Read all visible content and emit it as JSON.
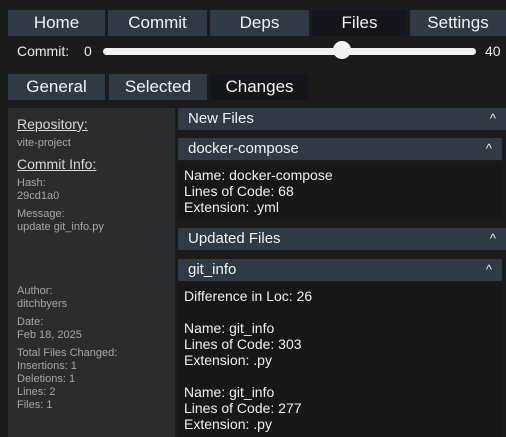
{
  "nav": {
    "tabs": [
      {
        "label": "Home"
      },
      {
        "label": "Commit"
      },
      {
        "label": "Deps"
      },
      {
        "label": "Files"
      },
      {
        "label": "Settings"
      }
    ],
    "active": "Files"
  },
  "commit_slider": {
    "label": "Commit:",
    "min": "0",
    "max": "40",
    "value_fraction": 0.64
  },
  "subtabs": [
    {
      "label": "General"
    },
    {
      "label": "Selected"
    },
    {
      "label": "Changes"
    }
  ],
  "sidebar": {
    "repository_heading": "Repository:",
    "repository": "vite-project",
    "commit_info_heading": "Commit Info:",
    "hash_label": "Hash:",
    "hash": "29cd1a0",
    "message_label": "Message:",
    "message": "update git_info.py",
    "author_label": "Author:",
    "author": "ditchbyers",
    "date_label": "Date:",
    "date": "Feb 18, 2025",
    "total_files_changed_label": "Total Files Changed:",
    "insertions": "Insertions: 1",
    "deletions": "Deletions: 1",
    "lines": "Lines: 2",
    "files": "Files: 1"
  },
  "new_files": {
    "header": "New Files",
    "caret": "^",
    "item": {
      "title": "docker-compose",
      "caret": "^",
      "name": "Name: docker-compose",
      "loc": "Lines of Code: 68",
      "ext": "Extension: .yml"
    }
  },
  "updated_files": {
    "header": "Updated Files",
    "caret": "^",
    "item": {
      "title": "git_info",
      "caret": "^",
      "diff": "Difference in Loc: 26",
      "current": {
        "name": "Name: git_info",
        "loc": "Lines of Code: 303",
        "ext": "Extension: .py"
      },
      "previous": {
        "name": "Name: git_info",
        "loc": "Lines of Code: 277",
        "ext": "Extension: .py"
      }
    }
  }
}
